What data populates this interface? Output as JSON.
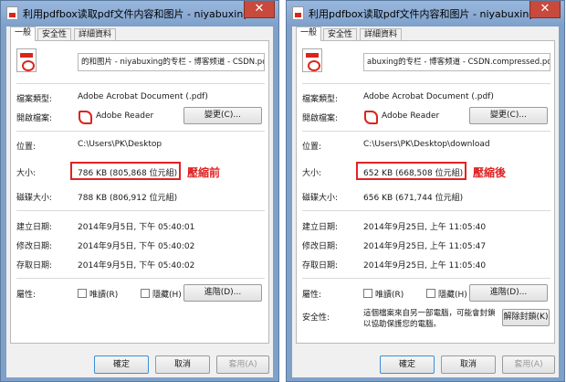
{
  "windows": [
    {
      "title": "利用pdfbox读取pdf文件内容和图片 - niyabuxing的...",
      "close_glyph": "✕",
      "tabs": [
        "一般",
        "安全性",
        "詳細資料"
      ],
      "filename": "的和图片 - niyabuxing的专栏 - 博客频道 - CSDN.pdf",
      "type_label": "檔案類型:",
      "type_value": "Adobe Acrobat Document (.pdf)",
      "open_with_label": "開啟檔案:",
      "open_with_app": "Adobe Reader",
      "change_button": "變更(C)...",
      "location_label": "位置:",
      "location_value": "C:\\Users\\PK\\Desktop",
      "size_label": "大小:",
      "size_value": "786 KB (805,868 位元組)",
      "annotation": "壓縮前",
      "disk_size_label": "磁碟大小:",
      "disk_size_value": "788 KB (806,912 位元組)",
      "created_label": "建立日期:",
      "created_value": "2014年9月5日, 下午 05:40:01",
      "modified_label": "修改日期:",
      "modified_value": "2014年9月5日, 下午 05:40:02",
      "accessed_label": "存取日期:",
      "accessed_value": "2014年9月5日, 下午 05:40:02",
      "attributes_label": "屬性:",
      "readonly_label": "唯讀(R)",
      "hidden_label": "隱藏(H)",
      "advanced_button": "進階(D)...",
      "ok_button": "確定",
      "cancel_button": "取消",
      "apply_button": "套用(A)"
    },
    {
      "title": "利用pdfbox读取pdf文件内容和图片 - niyabuxing的...",
      "close_glyph": "✕",
      "tabs": [
        "一般",
        "安全性",
        "詳細資料"
      ],
      "filename": "abuxing的专栏 - 博客频道 - CSDN.compressed.pdf",
      "type_label": "檔案類型:",
      "type_value": "Adobe Acrobat Document (.pdf)",
      "open_with_label": "開啟檔案:",
      "open_with_app": "Adobe Reader",
      "change_button": "變更(C)...",
      "location_label": "位置:",
      "location_value": "C:\\Users\\PK\\Desktop\\download",
      "size_label": "大小:",
      "size_value": "652 KB (668,508 位元組)",
      "annotation": "壓縮後",
      "disk_size_label": "磁碟大小:",
      "disk_size_value": "656 KB (671,744 位元組)",
      "created_label": "建立日期:",
      "created_value": "2014年9月25日, 上午 11:05:40",
      "modified_label": "修改日期:",
      "modified_value": "2014年9月25日, 上午 11:05:47",
      "accessed_label": "存取日期:",
      "accessed_value": "2014年9月25日, 上午 11:05:40",
      "attributes_label": "屬性:",
      "readonly_label": "唯讀(R)",
      "hidden_label": "隱藏(H)",
      "advanced_button": "進階(D)...",
      "security_label": "安全性:",
      "security_text": "這個檔案來自另一部電腦，可能會封鎖以協助保護您的電腦。",
      "unblock_button": "解除封鎖(K)",
      "ok_button": "確定",
      "cancel_button": "取消",
      "apply_button": "套用(A)"
    }
  ],
  "colors": {
    "accent": "#e02323",
    "titlebar": "#7fa2cc",
    "close": "#c74a3c"
  }
}
